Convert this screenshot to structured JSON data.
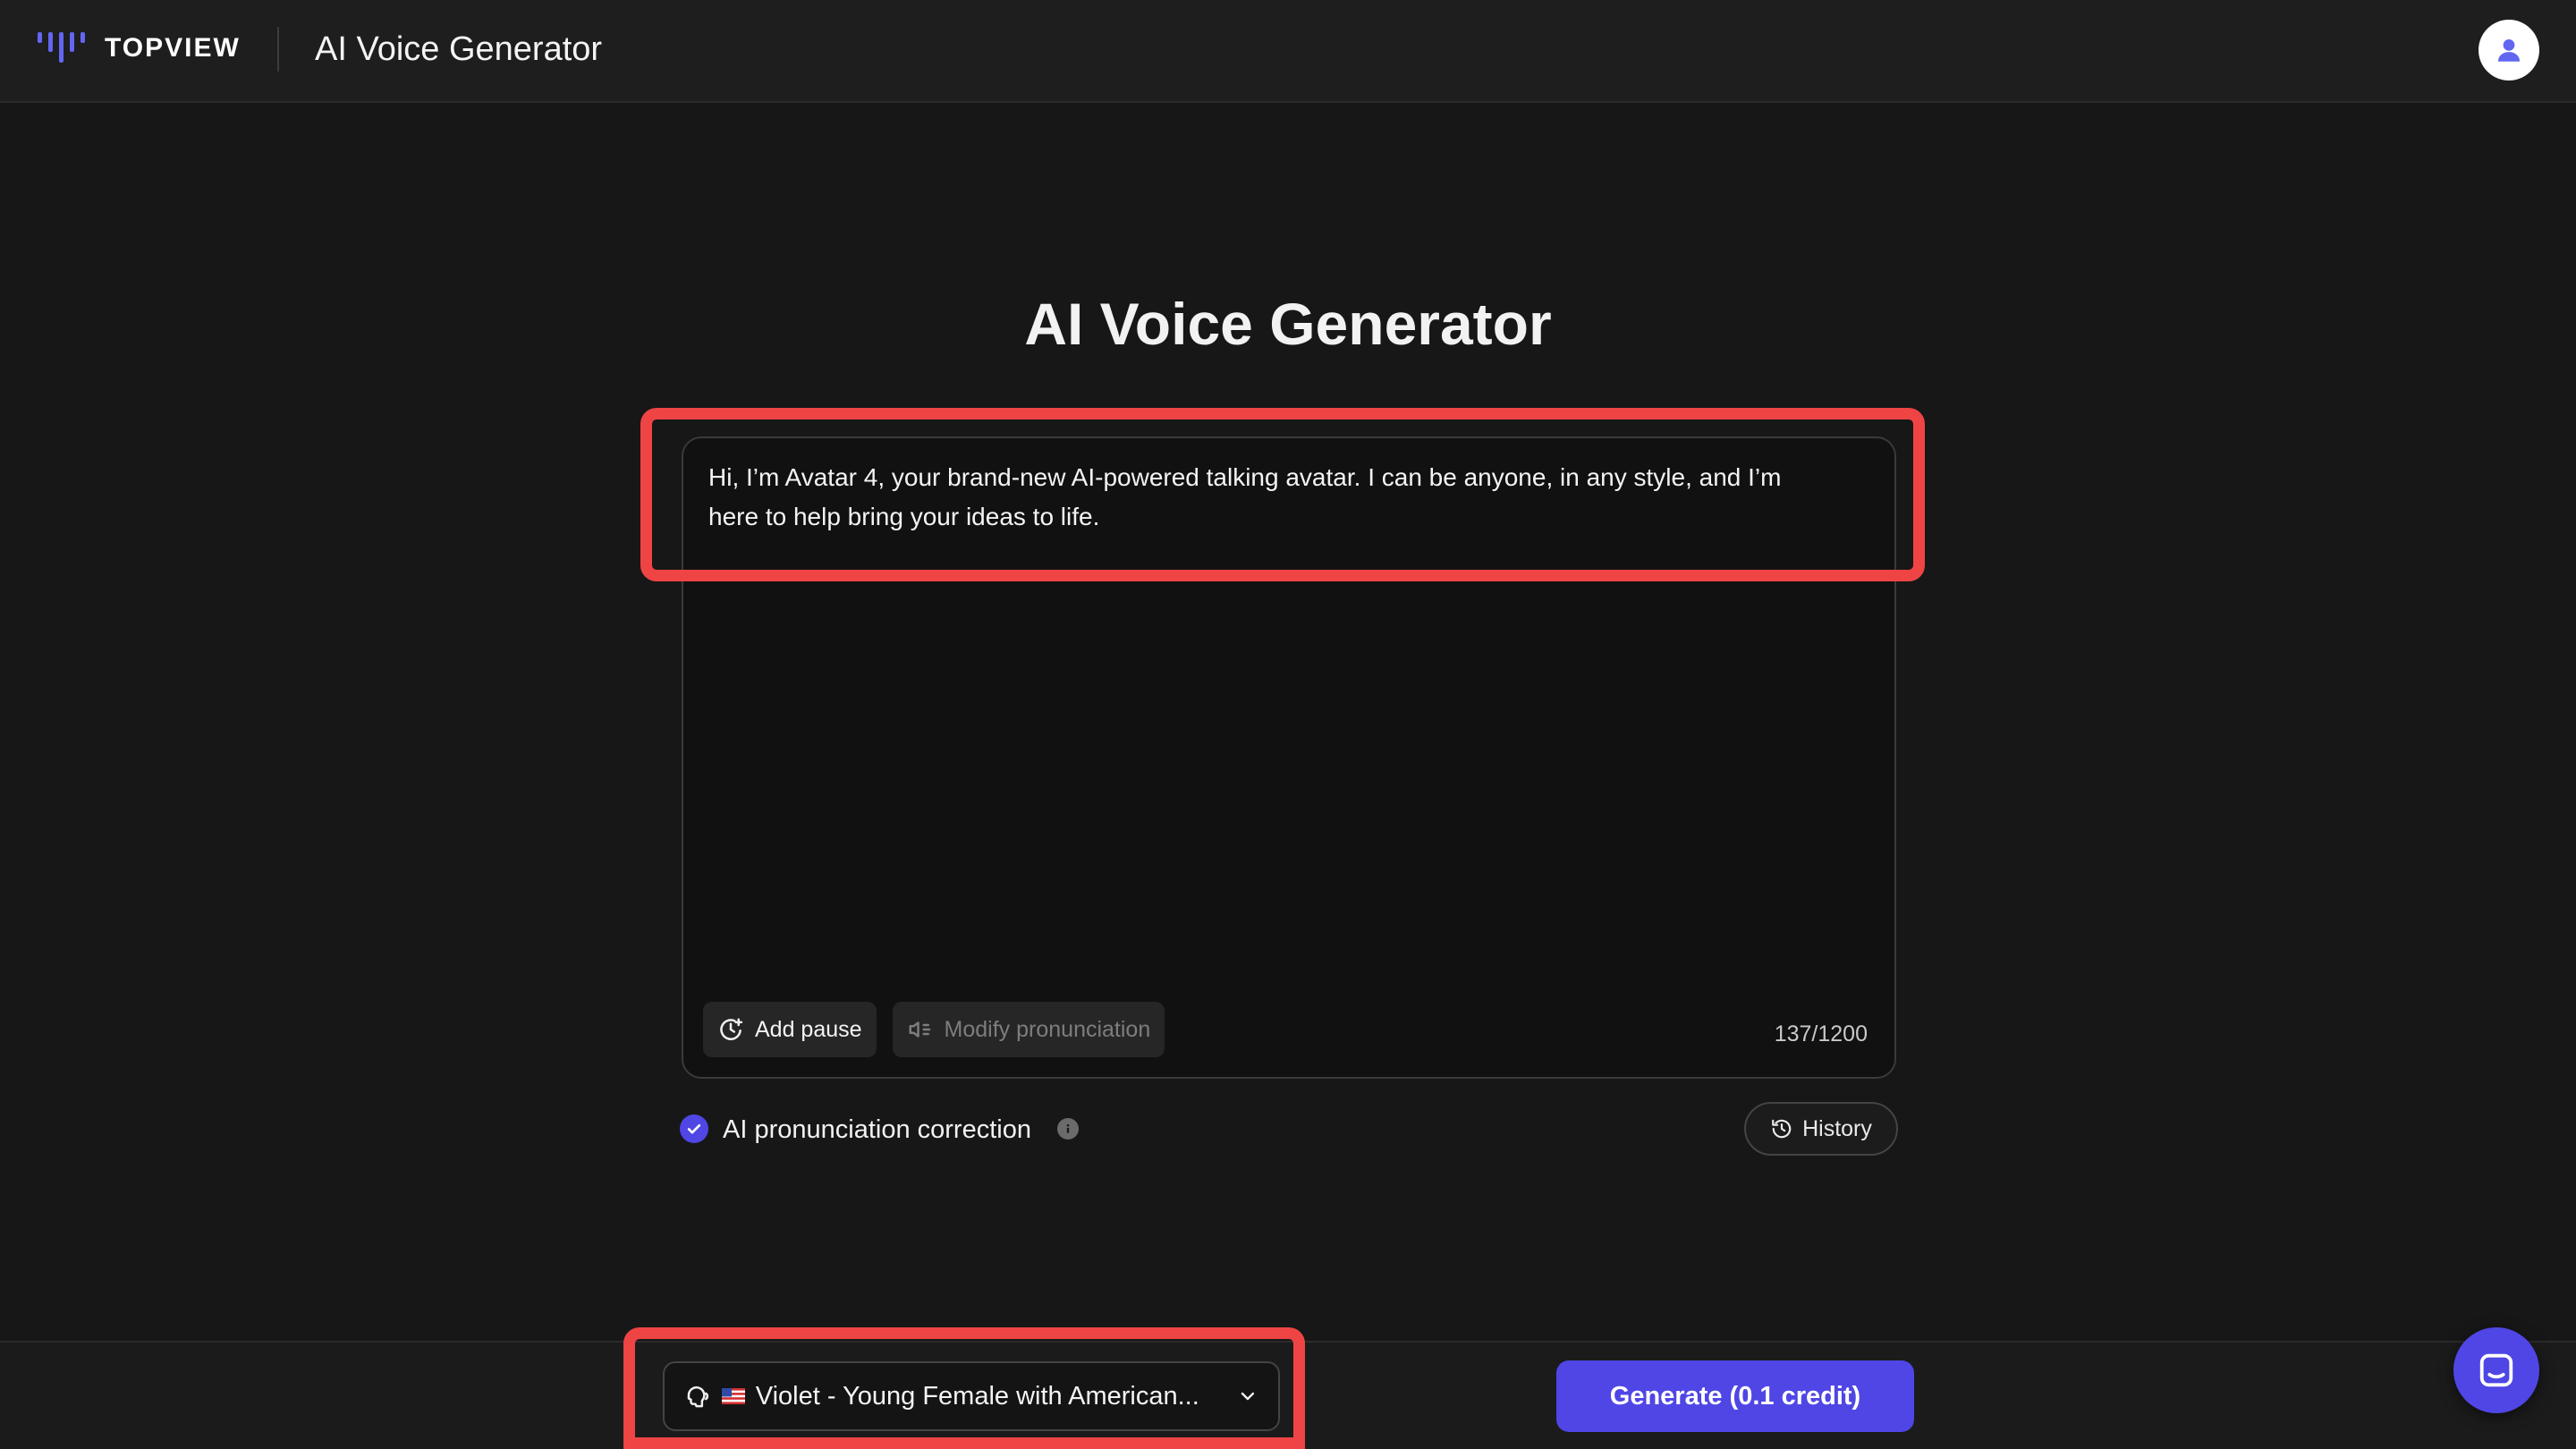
{
  "header": {
    "brand": "TOPVIEW",
    "title": "AI Voice Generator"
  },
  "main": {
    "title": "AI Voice Generator",
    "script_text": "Hi, I’m Avatar 4, your brand-new AI-powered talking avatar. I can be anyone, in any style, and I’m\nhere to help bring your ideas to life.",
    "add_pause_label": "Add pause",
    "modify_pronunciation_label": "Modify pronunciation",
    "char_count": "137/1200",
    "ai_correction_label": "AI pronunciation correction",
    "ai_correction_checked": true,
    "history_label": "History"
  },
  "footer": {
    "voice_label": "Violet - Young Female with American...",
    "voice_flag": "us-flag-icon",
    "generate_label": "Generate (0.1 credit)"
  },
  "colors": {
    "accent": "#4f46e5",
    "highlight": "#ef4444",
    "background": "#171717"
  }
}
